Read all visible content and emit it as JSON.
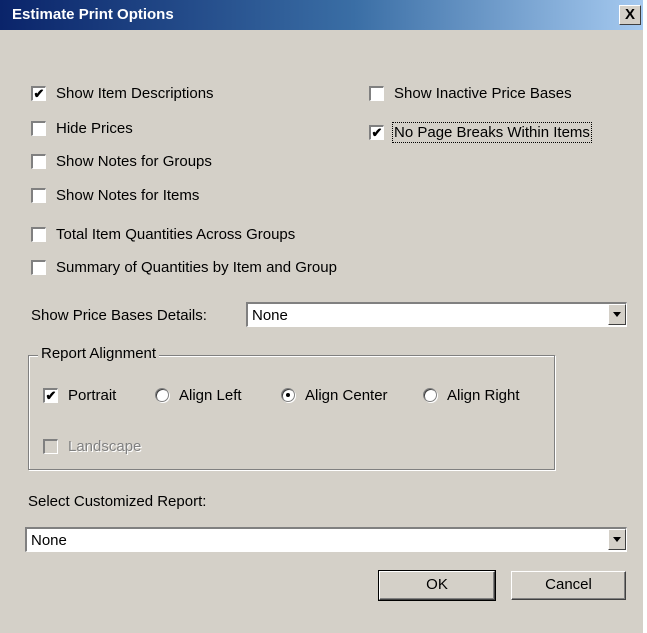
{
  "window": {
    "title": "Estimate Print Options",
    "close_label": "X"
  },
  "options": {
    "show_item_descriptions": {
      "label": "Show Item Descriptions",
      "checked": true
    },
    "hide_prices": {
      "label": "Hide Prices",
      "checked": false
    },
    "show_notes_groups": {
      "label": "Show Notes for Groups",
      "checked": false
    },
    "show_notes_items": {
      "label": "Show Notes for Items",
      "checked": false
    },
    "total_item_quantities": {
      "label": "Total Item Quantities Across Groups",
      "checked": false
    },
    "summary_quantities": {
      "label": "Summary of Quantities by Item and Group",
      "checked": false
    },
    "show_inactive_price_bases": {
      "label": "Show Inactive Price Bases",
      "checked": false
    },
    "no_page_breaks": {
      "label": "No Page Breaks Within Items",
      "checked": true
    }
  },
  "price_bases": {
    "label": "Show Price Bases Details:",
    "value": "None"
  },
  "alignment": {
    "legend": "Report Alignment",
    "portrait": {
      "label": "Portrait",
      "checked": true
    },
    "landscape": {
      "label": "Landscape",
      "checked": false,
      "disabled": true
    },
    "align_left": {
      "label": "Align Left",
      "selected": false
    },
    "align_center": {
      "label": "Align Center",
      "selected": true
    },
    "align_right": {
      "label": "Align Right",
      "selected": false
    }
  },
  "custom_report": {
    "label": "Select Customized Report:",
    "value": "None"
  },
  "buttons": {
    "ok": "OK",
    "cancel": "Cancel"
  },
  "check_glyph": "✔"
}
